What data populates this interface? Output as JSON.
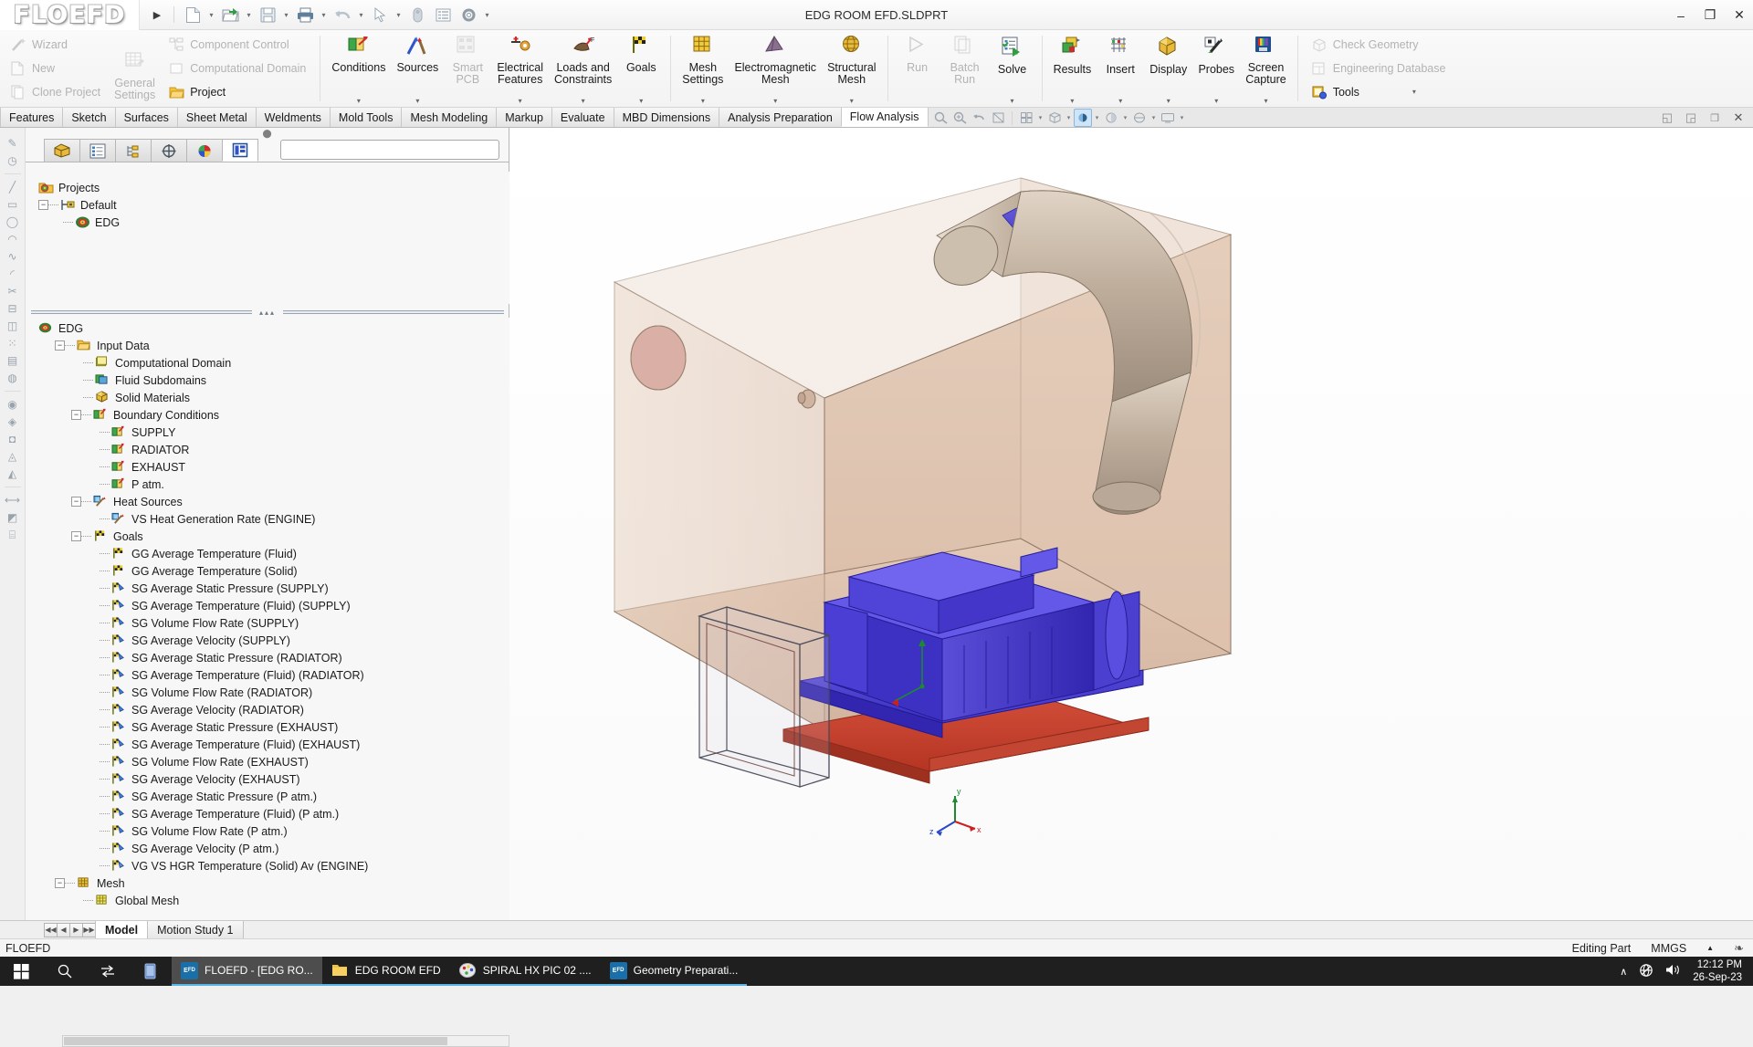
{
  "window": {
    "title": "EDG ROOM EFD.SLDPRT",
    "logo": "FLOEFD",
    "minimize": "–",
    "maximize": "❐",
    "close": "✕"
  },
  "quick_access": [
    {
      "name": "expand-ribbon-arrow",
      "glyph": "▶"
    },
    {
      "name": "new-document-icon",
      "glyph": "⬜"
    },
    {
      "name": "open-document-icon",
      "glyph": "📂"
    },
    {
      "name": "save-icon",
      "glyph": "💾"
    },
    {
      "name": "print-icon",
      "glyph": "🖨"
    },
    {
      "name": "undo-icon",
      "glyph": "↶"
    },
    {
      "name": "select-icon",
      "glyph": "➤"
    },
    {
      "name": "rebuild-icon",
      "glyph": "🔴"
    },
    {
      "name": "file-properties-icon",
      "glyph": "☰"
    },
    {
      "name": "options-icon",
      "glyph": "⚙"
    }
  ],
  "ribbon": {
    "col1": [
      {
        "label": "Wizard",
        "icon": "wizard-icon",
        "enabled": false
      },
      {
        "label": "New",
        "icon": "new-project-icon",
        "enabled": false
      },
      {
        "label": "Clone Project",
        "icon": "clone-project-icon",
        "enabled": false
      }
    ],
    "general_settings": {
      "label_line1": "General",
      "label_line2": "Settings",
      "icon": "general-settings-icon",
      "enabled": false
    },
    "col2": [
      {
        "label": "Component Control",
        "icon": "component-control-icon",
        "enabled": false
      },
      {
        "label": "Computational Domain",
        "icon": "computational-domain-icon",
        "enabled": false
      },
      {
        "label": "Project",
        "icon": "project-icon",
        "enabled": true,
        "caret": true
      }
    ],
    "big_buttons": [
      {
        "label1": "Conditions",
        "label2": "",
        "icon": "conditions-icon",
        "enabled": true,
        "caret": true
      },
      {
        "label1": "Sources",
        "label2": "",
        "icon": "sources-icon",
        "enabled": true,
        "caret": true
      },
      {
        "label1": "Smart",
        "label2": "PCB",
        "icon": "smart-pcb-icon",
        "enabled": false,
        "caret": false
      },
      {
        "label1": "Electrical",
        "label2": "Features",
        "icon": "electrical-features-icon",
        "enabled": true,
        "caret": true
      },
      {
        "label1": "Loads and",
        "label2": "Constraints",
        "icon": "loads-constraints-icon",
        "enabled": true,
        "caret": true
      },
      {
        "label1": "Goals",
        "label2": "",
        "icon": "goals-icon",
        "enabled": true,
        "caret": true
      },
      {
        "label1": "Mesh",
        "label2": "Settings",
        "icon": "mesh-settings-icon",
        "enabled": true,
        "caret": true
      },
      {
        "label1": "Electromagnetic",
        "label2": "Mesh",
        "icon": "electromagnetic-mesh-icon",
        "enabled": true,
        "caret": true
      },
      {
        "label1": "Structural",
        "label2": "Mesh",
        "icon": "structural-mesh-icon",
        "enabled": true,
        "caret": true
      },
      {
        "label1": "Run",
        "label2": "",
        "icon": "run-icon",
        "enabled": false,
        "caret": false
      },
      {
        "label1": "Batch",
        "label2": "Run",
        "icon": "batch-run-icon",
        "enabled": false,
        "caret": false
      },
      {
        "label1": "Solve",
        "label2": "",
        "icon": "solve-icon",
        "enabled": true,
        "caret": true
      },
      {
        "label1": "Results",
        "label2": "",
        "icon": "results-icon",
        "enabled": true,
        "caret": true
      },
      {
        "label1": "Insert",
        "label2": "",
        "icon": "insert-icon",
        "enabled": true,
        "caret": true
      },
      {
        "label1": "Display",
        "label2": "",
        "icon": "display-icon",
        "enabled": true,
        "caret": true
      },
      {
        "label1": "Probes",
        "label2": "",
        "icon": "probes-icon",
        "enabled": true,
        "caret": true
      },
      {
        "label1": "Screen",
        "label2": "Capture",
        "icon": "screen-capture-icon",
        "enabled": true,
        "caret": true
      }
    ],
    "col_right": [
      {
        "label": "Check Geometry",
        "icon": "check-geometry-icon",
        "enabled": false
      },
      {
        "label": "Engineering Database",
        "icon": "engineering-database-icon",
        "enabled": false
      },
      {
        "label": "Tools",
        "icon": "tools-icon",
        "enabled": true,
        "caret": true
      }
    ]
  },
  "command_tabs": [
    {
      "label": "Features",
      "active": false
    },
    {
      "label": "Sketch",
      "active": false
    },
    {
      "label": "Surfaces",
      "active": false
    },
    {
      "label": "Sheet Metal",
      "active": false
    },
    {
      "label": "Weldments",
      "active": false
    },
    {
      "label": "Mold Tools",
      "active": false
    },
    {
      "label": "Mesh Modeling",
      "active": false
    },
    {
      "label": "Markup",
      "active": false
    },
    {
      "label": "Evaluate",
      "active": false
    },
    {
      "label": "MBD Dimensions",
      "active": false
    },
    {
      "label": "Analysis Preparation",
      "active": false
    },
    {
      "label": "Flow Analysis",
      "active": true
    }
  ],
  "view_toolbar": [
    {
      "name": "zoom-to-fit-icon",
      "glyph": "⌕"
    },
    {
      "name": "zoom-to-area-icon",
      "glyph": "⌕"
    },
    {
      "name": "previous-view-icon",
      "glyph": "↶"
    },
    {
      "name": "section-view-icon",
      "glyph": "◧"
    },
    {
      "name": "view-orientation-icon",
      "glyph": "▦",
      "caret": true
    },
    {
      "name": "display-style-icon",
      "glyph": "▣",
      "caret": true
    },
    {
      "name": "hide-show-items-icon",
      "glyph": "◆",
      "caret": true,
      "active": true
    },
    {
      "name": "edit-appearance-icon",
      "glyph": "◔",
      "caret": true
    },
    {
      "name": "apply-scene-icon",
      "glyph": "●",
      "caret": true
    },
    {
      "name": "view-settings-icon",
      "glyph": "▭",
      "caret": true
    }
  ],
  "view_window_buttons": [
    {
      "name": "restore-viewport-left-icon",
      "glyph": "◱"
    },
    {
      "name": "restore-viewport-right-icon",
      "glyph": "◲"
    },
    {
      "name": "maximize-doc-icon",
      "glyph": "❐"
    },
    {
      "name": "close-doc-icon",
      "glyph": "✕"
    }
  ],
  "left_rail": [
    "sketch-rail-icon",
    "smart-dimension-rail-icon",
    "line-rail-icon",
    "rectangle-rail-icon",
    "circle-rail-icon",
    "arc-rail-icon",
    "spline-rail-icon",
    "fillet-rail-icon",
    "trim-rail-icon",
    "offset-rail-icon",
    "mirror-rail-icon",
    "pattern-rail-icon",
    "extrude-rail-icon",
    "revolve-rail-icon",
    "sweep-rail-icon",
    "loft-rail-icon",
    "shell-rail-icon",
    "rib-rail-icon",
    "draft-rail-icon",
    "measure-rail-icon",
    "section-rail-icon",
    "sensor-rail-icon"
  ],
  "feature_manager": {
    "tabs": [
      {
        "name": "feature-manager-tab",
        "glyph": "📦",
        "active": false
      },
      {
        "name": "property-manager-tab",
        "glyph": "☰",
        "active": false
      },
      {
        "name": "configuration-manager-tab",
        "glyph": "⑂",
        "active": false
      },
      {
        "name": "dimxpert-manager-tab",
        "glyph": "⊕",
        "active": false
      },
      {
        "name": "display-manager-tab",
        "glyph": "◕",
        "active": false
      },
      {
        "name": "flow-analysis-tree-tab",
        "glyph": "▤",
        "active": true
      }
    ],
    "search_placeholder": "",
    "project_tree": [
      {
        "label": "Projects",
        "depth": 0,
        "icon": "projects-folder-icon",
        "expander": null
      },
      {
        "label": "Default",
        "depth": 1,
        "icon": "configuration-icon",
        "expander": "-"
      },
      {
        "label": "EDG",
        "depth": 2,
        "icon": "project-node-icon",
        "expander": null
      }
    ],
    "analysis_tree": [
      {
        "label": "EDG",
        "depth": 0,
        "icon": "project-node-icon",
        "expander": null
      },
      {
        "label": "Input Data",
        "depth": 1,
        "icon": "input-data-icon",
        "expander": "-"
      },
      {
        "label": "Computational Domain",
        "depth": 2,
        "icon": "computational-domain-icon",
        "expander": null
      },
      {
        "label": "Fluid Subdomains",
        "depth": 2,
        "icon": "fluid-subdomains-icon",
        "expander": null
      },
      {
        "label": "Solid Materials",
        "depth": 2,
        "icon": "solid-materials-icon",
        "expander": null
      },
      {
        "label": "Boundary Conditions",
        "depth": 2,
        "icon": "boundary-conditions-icon",
        "expander": "-"
      },
      {
        "label": "SUPPLY",
        "depth": 3,
        "icon": "boundary-condition-icon",
        "expander": null
      },
      {
        "label": "RADIATOR",
        "depth": 3,
        "icon": "boundary-condition-icon",
        "expander": null
      },
      {
        "label": "EXHAUST",
        "depth": 3,
        "icon": "boundary-condition-icon",
        "expander": null
      },
      {
        "label": "P atm.",
        "depth": 3,
        "icon": "boundary-condition-icon",
        "expander": null
      },
      {
        "label": "Heat Sources",
        "depth": 2,
        "icon": "heat-sources-icon",
        "expander": "-"
      },
      {
        "label": "VS Heat Generation Rate (ENGINE)",
        "depth": 3,
        "icon": "heat-source-icon",
        "expander": null
      },
      {
        "label": "Goals",
        "depth": 2,
        "icon": "goals-folder-icon",
        "expander": "-"
      },
      {
        "label": "GG Average Temperature (Fluid)",
        "depth": 3,
        "icon": "global-goal-icon",
        "expander": null
      },
      {
        "label": "GG Average Temperature (Solid)",
        "depth": 3,
        "icon": "global-goal-icon",
        "expander": null
      },
      {
        "label": "SG Average Static Pressure (SUPPLY)",
        "depth": 3,
        "icon": "surface-goal-icon",
        "expander": null
      },
      {
        "label": "SG Average Temperature (Fluid) (SUPPLY)",
        "depth": 3,
        "icon": "surface-goal-icon",
        "expander": null
      },
      {
        "label": "SG Volume Flow Rate (SUPPLY)",
        "depth": 3,
        "icon": "surface-goal-icon",
        "expander": null
      },
      {
        "label": "SG Average Velocity (SUPPLY)",
        "depth": 3,
        "icon": "surface-goal-icon",
        "expander": null
      },
      {
        "label": "SG Average Static Pressure (RADIATOR)",
        "depth": 3,
        "icon": "surface-goal-icon",
        "expander": null
      },
      {
        "label": "SG Average Temperature (Fluid) (RADIATOR)",
        "depth": 3,
        "icon": "surface-goal-icon",
        "expander": null
      },
      {
        "label": "SG Volume Flow Rate (RADIATOR)",
        "depth": 3,
        "icon": "surface-goal-icon",
        "expander": null
      },
      {
        "label": "SG Average Velocity (RADIATOR)",
        "depth": 3,
        "icon": "surface-goal-icon",
        "expander": null
      },
      {
        "label": "SG Average Static Pressure (EXHAUST)",
        "depth": 3,
        "icon": "surface-goal-icon",
        "expander": null
      },
      {
        "label": "SG Average Temperature (Fluid) (EXHAUST)",
        "depth": 3,
        "icon": "surface-goal-icon",
        "expander": null
      },
      {
        "label": "SG Volume Flow Rate (EXHAUST)",
        "depth": 3,
        "icon": "surface-goal-icon",
        "expander": null
      },
      {
        "label": "SG Average Velocity (EXHAUST)",
        "depth": 3,
        "icon": "surface-goal-icon",
        "expander": null
      },
      {
        "label": "SG Average Static Pressure (P atm.)",
        "depth": 3,
        "icon": "surface-goal-icon",
        "expander": null
      },
      {
        "label": "SG Average Temperature (Fluid) (P atm.)",
        "depth": 3,
        "icon": "surface-goal-icon",
        "expander": null
      },
      {
        "label": "SG Volume Flow Rate (P atm.)",
        "depth": 3,
        "icon": "surface-goal-icon",
        "expander": null
      },
      {
        "label": "SG Average Velocity (P atm.)",
        "depth": 3,
        "icon": "surface-goal-icon",
        "expander": null
      },
      {
        "label": "VG VS HGR Temperature (Solid) Av (ENGINE)",
        "depth": 3,
        "icon": "volume-goal-icon",
        "expander": null
      },
      {
        "label": "Mesh",
        "depth": 1,
        "icon": "mesh-folder-icon",
        "expander": "-"
      },
      {
        "label": "Global Mesh",
        "depth": 2,
        "icon": "global-mesh-icon",
        "expander": null
      }
    ]
  },
  "graphics": {
    "triad_x": "x",
    "triad_y": "y",
    "triad_z": "z"
  },
  "model_tabs": {
    "nav": [
      "⏮",
      "◀",
      "▶",
      "⏭"
    ],
    "tabs": [
      {
        "label": "Model",
        "active": true
      },
      {
        "label": "Motion Study 1",
        "active": false
      }
    ]
  },
  "status_bar": {
    "left": "FLOEFD",
    "editing": "Editing Part",
    "units": "MMGS",
    "caret": "▲",
    "overlay_icon": "quick-tips-icon"
  },
  "taskbar": {
    "system": [
      {
        "name": "start-button-icon",
        "glyph": "⊞"
      },
      {
        "name": "search-icon",
        "glyph": "⚲"
      },
      {
        "name": "task-view-icon",
        "glyph": "⇆"
      },
      {
        "name": "phone-link-icon",
        "glyph": "▯"
      }
    ],
    "apps": [
      {
        "label": "FLOEFD - [EDG RO...",
        "icon_text": "EFD",
        "icon_color": "#1b6fa8",
        "active": true,
        "open": true
      },
      {
        "label": "EDG ROOM EFD",
        "icon_text": "",
        "icon_color": "#f0c244",
        "active": false,
        "open": true
      },
      {
        "label": "SPIRAL HX PIC 02 ....",
        "icon_text": "",
        "icon_color": "#d8d8d8",
        "active": false,
        "open": true
      },
      {
        "label": "Geometry Preparati...",
        "icon_text": "EFD",
        "icon_color": "#1b6fa8",
        "active": false,
        "open": true
      }
    ],
    "tray": [
      {
        "name": "show-hidden-icons-chevron",
        "glyph": "∧"
      },
      {
        "name": "network-disconnected-icon",
        "glyph": "⊕"
      },
      {
        "name": "volume-icon",
        "glyph": "🔊"
      }
    ],
    "time": "12:12 PM",
    "date": "26-Sep-23"
  },
  "colors": {
    "accent": "#2b5f8e",
    "ribbon_bg": "#f3f3f3",
    "tree_bg": "#f7f7f7",
    "taskbar_bg": "#1f1f1f",
    "model_enclosure": "#d8bba6",
    "model_engine": "#4a3fc4",
    "model_base": "#c0392b",
    "model_duct": "#c9b49e",
    "model_collar": "#5a4fd8"
  }
}
